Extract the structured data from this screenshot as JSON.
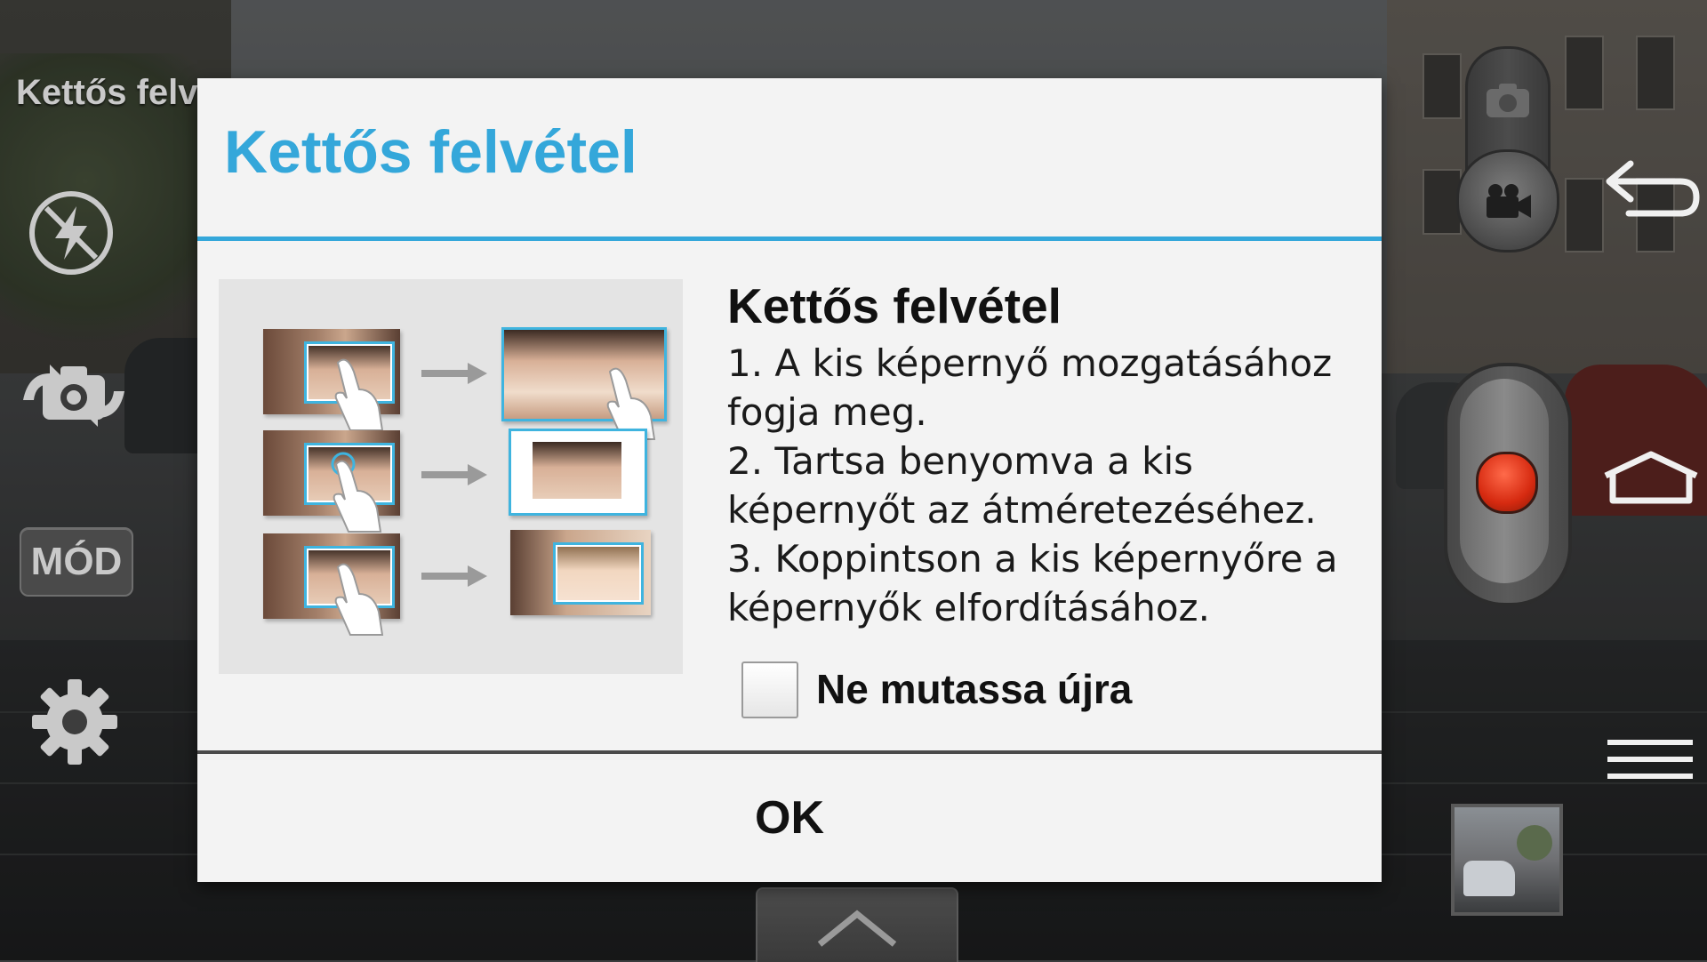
{
  "camera": {
    "mode_title": "Kettős felv",
    "mode_button_label": "MÓD",
    "icons": {
      "flash": "flash-off-icon",
      "swap": "camera-swap-icon",
      "settings": "gear-icon",
      "photo": "camera-icon",
      "video": "video-camera-icon",
      "record": "record-icon",
      "gallery": "gallery-thumbnail",
      "expand": "chevron-up-icon"
    }
  },
  "system_nav": {
    "back": "back-icon",
    "home": "home-icon",
    "menu": "menu-icon"
  },
  "dialog": {
    "title": "Kettős felvétel",
    "heading": "Kettős felvétel",
    "lines": [
      "1. A kis képernyő mozgatásához",
      "fogja meg.",
      "2. Tartsa benyomva a kis",
      "képernyőt az átméretezéséhez.",
      "3. Koppintson a kis képernyőre a",
      "képernyők elfordításához."
    ],
    "checkbox_label": "Ne mutassa újra",
    "checkbox_checked": false,
    "ok_label": "OK"
  },
  "colors": {
    "accent": "#34a7da",
    "dialog_bg": "#f3f3f3",
    "record": "#d62a10"
  }
}
